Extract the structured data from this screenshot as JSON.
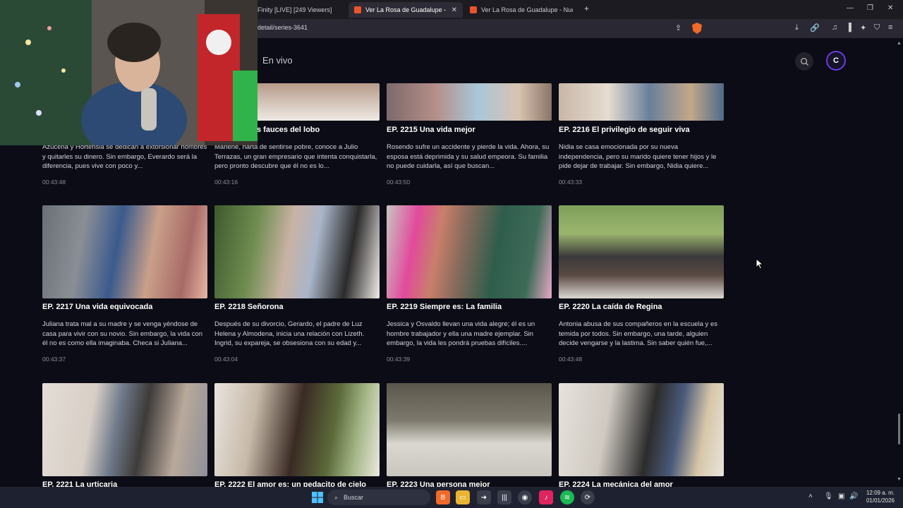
{
  "browser": {
    "tabs": [
      {
        "label": "Finity [LIVE] [249 Viewers]",
        "active": false
      },
      {
        "label": "Ver La Rosa de Guadalupe - Nue",
        "active": true
      },
      {
        "label": "Ver La Rosa de Guadalupe - Nuevos e",
        "active": false
      }
    ],
    "new_tab_label": "+",
    "url": "detail/series-3641"
  },
  "site": {
    "nav_live": "En vivo",
    "avatar_letter": "C",
    "accent_color": "#6b3be0"
  },
  "episodes_top": [
    {
      "title": "s fauces del lobo",
      "desc": "Marlene, harta de sentirse pobre, conoce a Julio Terrazas, un gran empresario que intenta conquistarla, pero pronto descubre que él no es lo...",
      "duration": "00:43:16"
    },
    {
      "title": "EP. 2215  Una vida mejor",
      "desc": "Rosendo sufre un accidente y pierde la vida. Ahora, su esposa está deprimida y su salud empeora. Su familia no puede cuidarla, así que buscan...",
      "duration": "00:43:50"
    },
    {
      "title": "EP. 2216  El privilegio de seguir viva",
      "desc": "Nidia se casa emocionada por su nueva independencia, pero su marido quiere tener hijos y le pide dejar de trabajar. Sin embargo, Nidia quiere...",
      "duration": "00:43:33"
    }
  ],
  "episode_partial_left": {
    "desc": "Azucena y Hortensia se dedican a extorsionar hombres y quitarles su dinero. Sin embargo, Everardo será la diferencia, pues vive con poco y...",
    "duration": "00:43:48"
  },
  "episodes_mid": [
    {
      "title": "EP. 2217  Una vida equivocada",
      "desc": "Juliana trata mal a su madre y se venga yéndose de casa para vivir con su novio. Sin embargo, la vida con él no es como ella imaginaba. Checa si Juliana...",
      "duration": "00:43:37"
    },
    {
      "title": "EP. 2218  Señorona",
      "desc": "Después de su divorcio, Gerardo, el padre de Luz Helena y Almodena, inicia una relación con Lizeth. Ingrid, su expareja, se obsesiona con su edad y...",
      "duration": "00:43:04"
    },
    {
      "title": "EP. 2219  Siempre es: La familia",
      "desc": "Jessica y Osvaldo llevan una vida alegre; él es un hombre trabajador y ella una madre ejemplar. Sin embargo, la vida les pondrá pruebas difíciles....",
      "duration": "00:43:39"
    },
    {
      "title": "EP. 2220  La caída de Regina",
      "desc": "Antonia abusa de sus compañeros en la escuela y es temida por todos. Sin embargo, una tarde, alguien decide vengarse y la lastima. Sin saber quién fue,...",
      "duration": "00:43:48"
    }
  ],
  "episodes_bottom": [
    {
      "title": "EP. 2221  La urticaria"
    },
    {
      "title": "EP. 2222  El amor es: un pedacito de cielo"
    },
    {
      "title": "EP. 2223  Una persona mejor"
    },
    {
      "title": "EP. 2224  La mecánica del amor"
    }
  ],
  "taskbar": {
    "search_placeholder": "Buscar",
    "time": "12:09 a. m.",
    "date": "01/01/2026"
  }
}
